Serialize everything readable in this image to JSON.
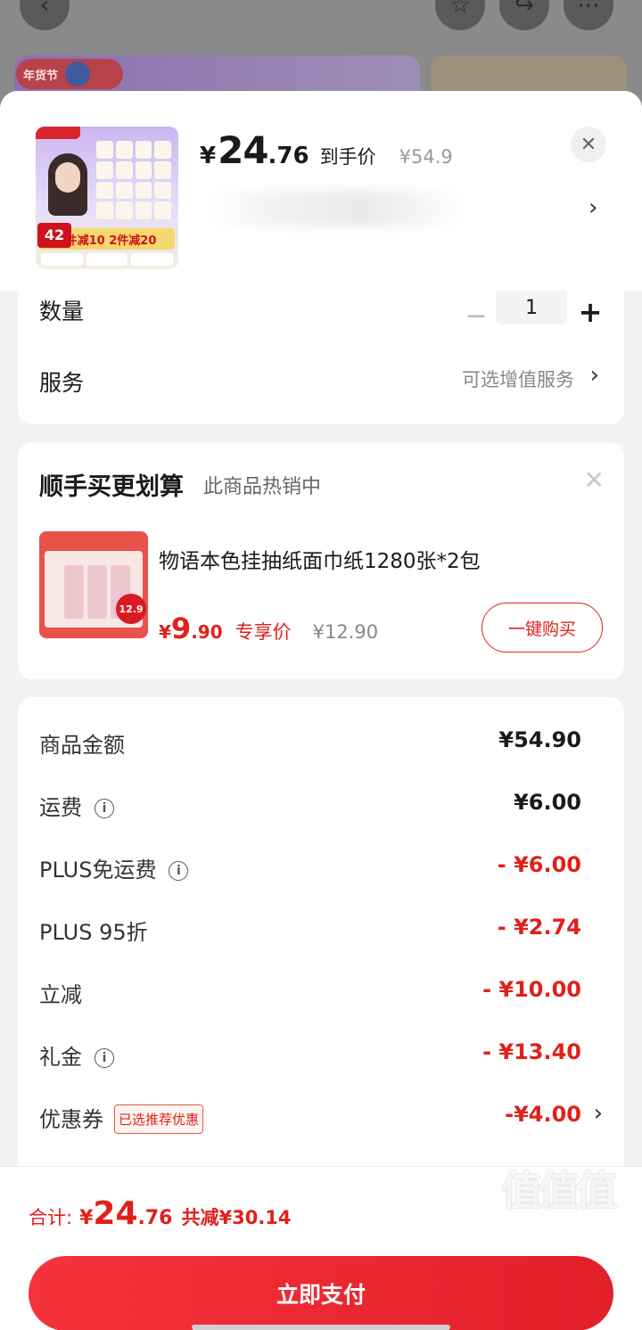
{
  "background": {
    "badge_text": "年货节"
  },
  "product": {
    "price_symbol": "¥",
    "price_integer": "24",
    "price_decimal": ".76",
    "price_label": "到手价",
    "original_price": "¥54.9",
    "thumb_promo": "1件减10 2件减20",
    "thumb_number": "42"
  },
  "quantity": {
    "label": "数量",
    "value": "1",
    "minus": "−",
    "plus": "+"
  },
  "service": {
    "label": "服务",
    "value": "可选增值服务"
  },
  "addon": {
    "title": "顺手买更划算",
    "subtitle": "此商品热销中",
    "name": "物语本色挂抽纸面巾纸1280张*2包",
    "price_symbol": "¥",
    "price_integer": "9",
    "price_decimal": ".90",
    "price_label": "专享价",
    "original_price": "¥12.90",
    "sticker": "12.9",
    "buy_label": "一键购买"
  },
  "summary": {
    "rows": [
      {
        "label": "商品金额",
        "value": "¥54.90",
        "info": false,
        "red": false
      },
      {
        "label": "运费",
        "value": "¥6.00",
        "info": true,
        "red": false
      },
      {
        "label": "PLUS免运费",
        "value": "- ¥6.00",
        "info": true,
        "red": true
      },
      {
        "label": "PLUS 95折",
        "value": "- ¥2.74",
        "info": false,
        "red": true
      },
      {
        "label": "立减",
        "value": "- ¥10.00",
        "info": false,
        "red": true
      },
      {
        "label": "礼金",
        "value": "- ¥13.40",
        "info": true,
        "red": true
      }
    ],
    "coupon": {
      "label": "优惠券",
      "tag": "已选推荐优惠",
      "value": "-¥4.00"
    }
  },
  "footer": {
    "total_label": "合计:",
    "total_symbol": "¥",
    "total_integer": "24",
    "total_decimal": ".76",
    "saved": "共减¥30.14",
    "pay_label": "立即支付"
  },
  "watermark": {
    "glyphs": "值值值",
    "url": "zhizhizhi.com"
  },
  "colors": {
    "accent": "#e0201b",
    "pay_button": "#f4333c"
  }
}
